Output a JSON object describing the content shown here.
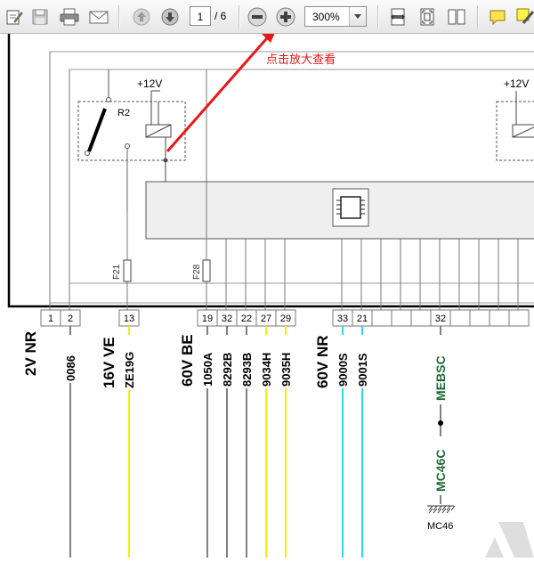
{
  "toolbar": {
    "page_current": "1",
    "page_total": "/ 6",
    "zoom": "300%"
  },
  "annotation": {
    "text": "点击放大查看",
    "color": "#e8181a"
  },
  "schematic": {
    "supply_left": "+12V",
    "supply_right": "+12V",
    "relay_label": "R2",
    "fuse_left": "F21",
    "fuse_right": "F28",
    "pins": [
      "1",
      "2",
      "13",
      "19",
      "32",
      "22",
      "27",
      "29",
      "33",
      "21",
      "32"
    ],
    "connectors": [
      "2V NR",
      "16V VE",
      "60V BE",
      "60V NR"
    ],
    "wires": [
      "0086",
      "ZE19G",
      "1050A",
      "8292B",
      "8293B",
      "9034H",
      "9035H",
      "9000S",
      "9001S"
    ],
    "green_labels": [
      "MEBSC",
      "MC46C"
    ],
    "ground_label": "MC46",
    "colors": {
      "yellow_wire": "#f4f000",
      "cyan_wire": "#2ed9e8",
      "green_text": "#1e6b34"
    }
  }
}
